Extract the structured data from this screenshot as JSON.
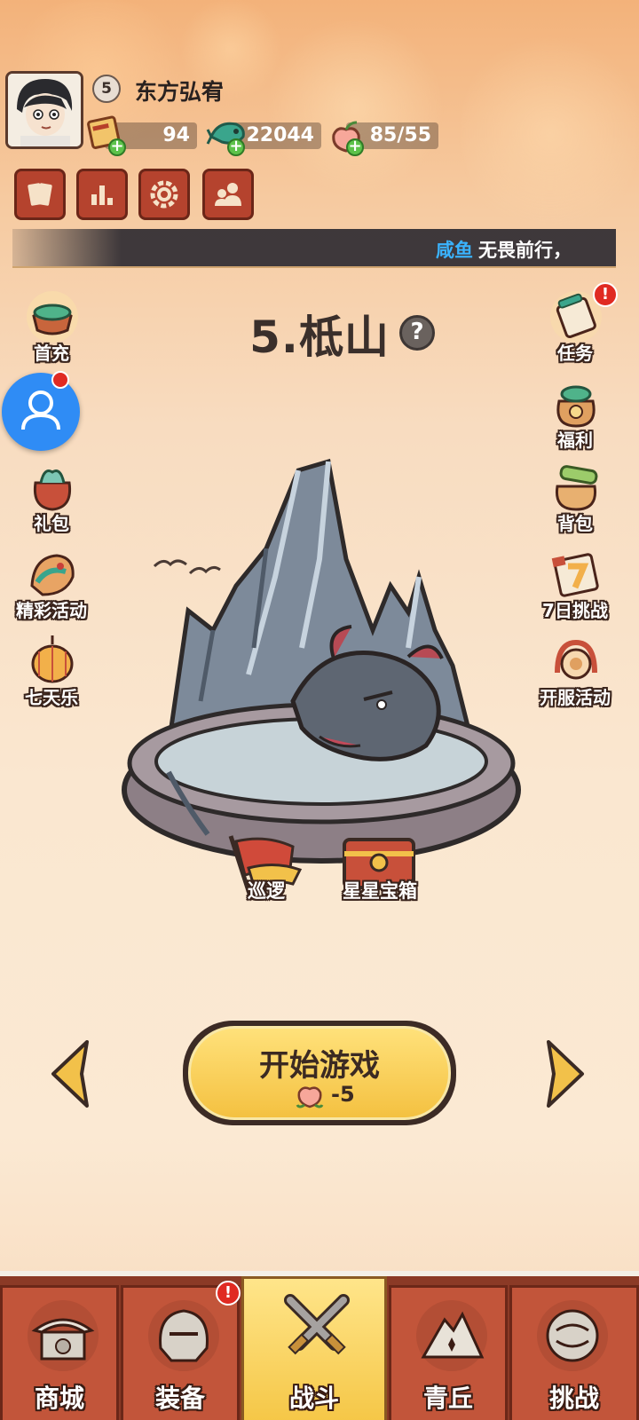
{
  "player": {
    "name": "东方弘宥",
    "level": "5"
  },
  "resources": {
    "scrolls": "94",
    "coins": "22044",
    "stamina": "85/55"
  },
  "marquee": {
    "highlight": "咸鱼",
    "text": "无畏前行，"
  },
  "stage": {
    "title": "5.柢山",
    "help": "?"
  },
  "left_buttons": {
    "first_charge": "首充",
    "gift": "礼包",
    "events": "精彩活动",
    "seven_days": "七天乐"
  },
  "right_buttons": {
    "tasks": "任务",
    "welfare": "福利",
    "bag": "背包",
    "seven_day_challenge": "7日挑战",
    "server_event": "开服活动"
  },
  "badges": {
    "tasks": "!",
    "equip": "!"
  },
  "scene": {
    "patrol": "巡逻",
    "star_chest": "星星宝箱"
  },
  "start": {
    "label": "开始游戏",
    "cost": "-5"
  },
  "nav": {
    "shop": "商城",
    "equip": "装备",
    "battle": "战斗",
    "qingqiu": "青丘",
    "challenge": "挑战"
  },
  "colors": {
    "accent": "#f5c645",
    "nav_bg": "#8b3a26",
    "tab_bg": "#c2553a",
    "marquee_highlight": "#3ab3ff",
    "badge_red": "#e02a22"
  }
}
